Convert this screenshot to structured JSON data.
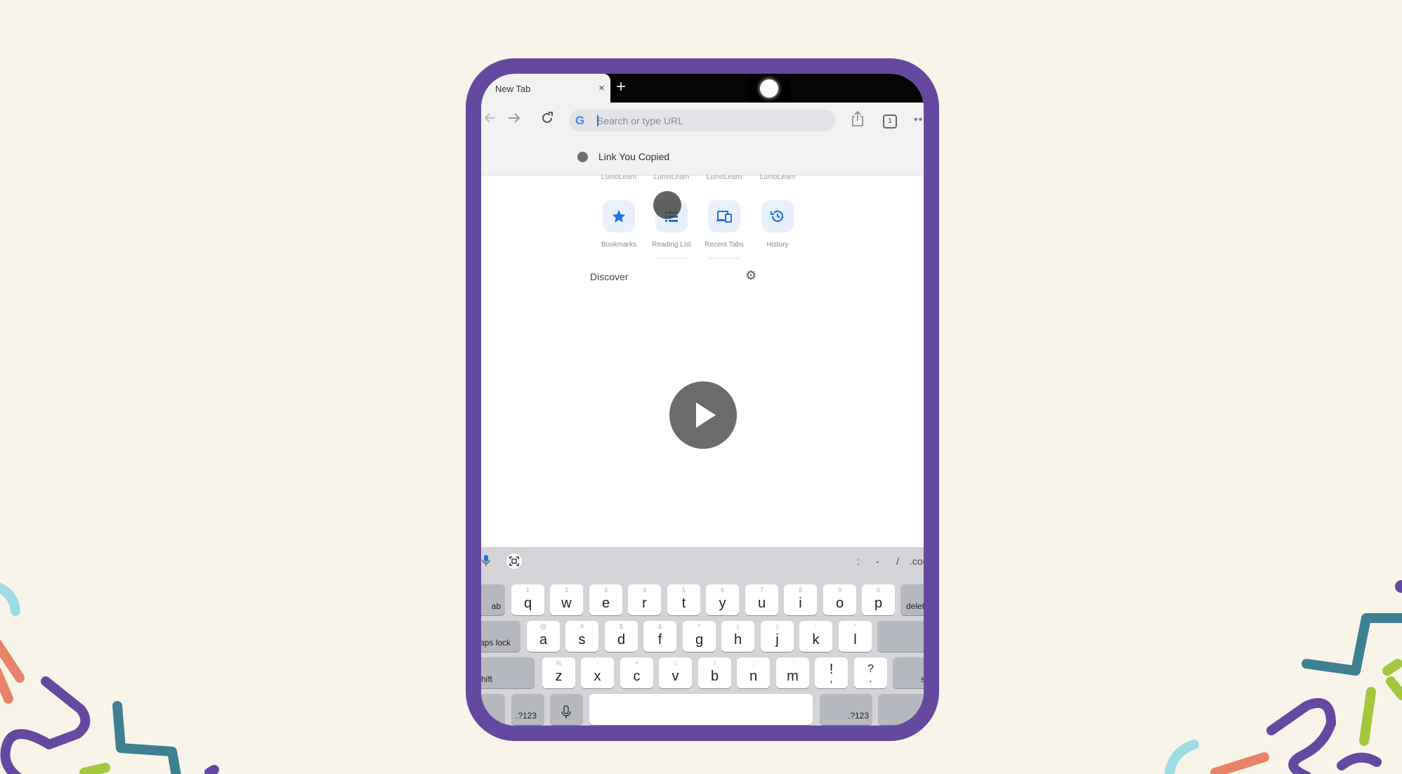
{
  "browser": {
    "tab_title": "New Tab",
    "tab_close": "×",
    "new_tab": "+",
    "omnibox_placeholder": "Search or type URL",
    "google_logo": "G",
    "tab_count": "1",
    "suggestion": "Link You Copied",
    "most_visited": [
      "LumoLearn",
      "LumoLearn",
      "LumoLearn",
      "LumoLearn"
    ],
    "shortcuts": [
      {
        "label": "Bookmarks",
        "icon": "star-icon"
      },
      {
        "label": "Reading List",
        "icon": "list-icon"
      },
      {
        "label": "Recent Tabs",
        "icon": "devices-icon"
      },
      {
        "label": "History",
        "icon": "history-icon"
      }
    ],
    "discover_label": "Discover"
  },
  "keyboard": {
    "accessory_punct": [
      ":",
      "-",
      "/",
      ".com"
    ],
    "row1": [
      {
        "main": "q",
        "hint": "1"
      },
      {
        "main": "w",
        "hint": "2"
      },
      {
        "main": "e",
        "hint": "3"
      },
      {
        "main": "r",
        "hint": "4"
      },
      {
        "main": "t",
        "hint": "5"
      },
      {
        "main": "y",
        "hint": "6"
      },
      {
        "main": "u",
        "hint": "7"
      },
      {
        "main": "i",
        "hint": "8"
      },
      {
        "main": "o",
        "hint": "9"
      },
      {
        "main": "p",
        "hint": "0"
      }
    ],
    "row2": [
      {
        "main": "a",
        "hint": "@"
      },
      {
        "main": "s",
        "hint": "#"
      },
      {
        "main": "d",
        "hint": "$"
      },
      {
        "main": "f",
        "hint": "&"
      },
      {
        "main": "g",
        "hint": "*"
      },
      {
        "main": "h",
        "hint": "("
      },
      {
        "main": "j",
        "hint": ")"
      },
      {
        "main": "k",
        "hint": "'"
      },
      {
        "main": "l",
        "hint": "\""
      }
    ],
    "row3": [
      {
        "main": "z",
        "hint": "%"
      },
      {
        "main": "x",
        "hint": "-"
      },
      {
        "main": "c",
        "hint": "+"
      },
      {
        "main": "v",
        "hint": "="
      },
      {
        "main": "b",
        "hint": "/"
      },
      {
        "main": "n",
        "hint": ";"
      },
      {
        "main": "m",
        "hint": ":"
      },
      {
        "main": "!",
        "hint": ","
      },
      {
        "main": "?",
        "hint": "."
      }
    ],
    "tab_label": "ab",
    "delete_label": "delet",
    "caps_label": "aps lock",
    "shift_left_label": "hift",
    "shift_right_label": "shi",
    "num_label_left": ".?123",
    "num_label_right": ".?123"
  },
  "colors": {
    "tablet_frame": "#6549a0",
    "background": "#f8f4ea",
    "accent_blue": "#1a73e8"
  }
}
